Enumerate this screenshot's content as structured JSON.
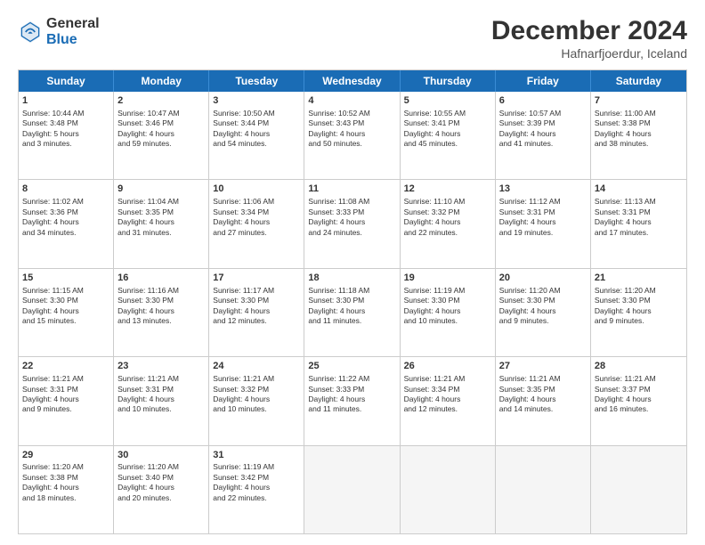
{
  "logo": {
    "general": "General",
    "blue": "Blue"
  },
  "header": {
    "month": "December 2024",
    "location": "Hafnarfjoerdur, Iceland"
  },
  "days": [
    "Sunday",
    "Monday",
    "Tuesday",
    "Wednesday",
    "Thursday",
    "Friday",
    "Saturday"
  ],
  "weeks": [
    [
      {
        "day": "1",
        "info": "Sunrise: 10:44 AM\nSunset: 3:48 PM\nDaylight: 5 hours\nand 3 minutes."
      },
      {
        "day": "2",
        "info": "Sunrise: 10:47 AM\nSunset: 3:46 PM\nDaylight: 4 hours\nand 59 minutes."
      },
      {
        "day": "3",
        "info": "Sunrise: 10:50 AM\nSunset: 3:44 PM\nDaylight: 4 hours\nand 54 minutes."
      },
      {
        "day": "4",
        "info": "Sunrise: 10:52 AM\nSunset: 3:43 PM\nDaylight: 4 hours\nand 50 minutes."
      },
      {
        "day": "5",
        "info": "Sunrise: 10:55 AM\nSunset: 3:41 PM\nDaylight: 4 hours\nand 45 minutes."
      },
      {
        "day": "6",
        "info": "Sunrise: 10:57 AM\nSunset: 3:39 PM\nDaylight: 4 hours\nand 41 minutes."
      },
      {
        "day": "7",
        "info": "Sunrise: 11:00 AM\nSunset: 3:38 PM\nDaylight: 4 hours\nand 38 minutes."
      }
    ],
    [
      {
        "day": "8",
        "info": "Sunrise: 11:02 AM\nSunset: 3:36 PM\nDaylight: 4 hours\nand 34 minutes."
      },
      {
        "day": "9",
        "info": "Sunrise: 11:04 AM\nSunset: 3:35 PM\nDaylight: 4 hours\nand 31 minutes."
      },
      {
        "day": "10",
        "info": "Sunrise: 11:06 AM\nSunset: 3:34 PM\nDaylight: 4 hours\nand 27 minutes."
      },
      {
        "day": "11",
        "info": "Sunrise: 11:08 AM\nSunset: 3:33 PM\nDaylight: 4 hours\nand 24 minutes."
      },
      {
        "day": "12",
        "info": "Sunrise: 11:10 AM\nSunset: 3:32 PM\nDaylight: 4 hours\nand 22 minutes."
      },
      {
        "day": "13",
        "info": "Sunrise: 11:12 AM\nSunset: 3:31 PM\nDaylight: 4 hours\nand 19 minutes."
      },
      {
        "day": "14",
        "info": "Sunrise: 11:13 AM\nSunset: 3:31 PM\nDaylight: 4 hours\nand 17 minutes."
      }
    ],
    [
      {
        "day": "15",
        "info": "Sunrise: 11:15 AM\nSunset: 3:30 PM\nDaylight: 4 hours\nand 15 minutes."
      },
      {
        "day": "16",
        "info": "Sunrise: 11:16 AM\nSunset: 3:30 PM\nDaylight: 4 hours\nand 13 minutes."
      },
      {
        "day": "17",
        "info": "Sunrise: 11:17 AM\nSunset: 3:30 PM\nDaylight: 4 hours\nand 12 minutes."
      },
      {
        "day": "18",
        "info": "Sunrise: 11:18 AM\nSunset: 3:30 PM\nDaylight: 4 hours\nand 11 minutes."
      },
      {
        "day": "19",
        "info": "Sunrise: 11:19 AM\nSunset: 3:30 PM\nDaylight: 4 hours\nand 10 minutes."
      },
      {
        "day": "20",
        "info": "Sunrise: 11:20 AM\nSunset: 3:30 PM\nDaylight: 4 hours\nand 9 minutes."
      },
      {
        "day": "21",
        "info": "Sunrise: 11:20 AM\nSunset: 3:30 PM\nDaylight: 4 hours\nand 9 minutes."
      }
    ],
    [
      {
        "day": "22",
        "info": "Sunrise: 11:21 AM\nSunset: 3:31 PM\nDaylight: 4 hours\nand 9 minutes."
      },
      {
        "day": "23",
        "info": "Sunrise: 11:21 AM\nSunset: 3:31 PM\nDaylight: 4 hours\nand 10 minutes."
      },
      {
        "day": "24",
        "info": "Sunrise: 11:21 AM\nSunset: 3:32 PM\nDaylight: 4 hours\nand 10 minutes."
      },
      {
        "day": "25",
        "info": "Sunrise: 11:22 AM\nSunset: 3:33 PM\nDaylight: 4 hours\nand 11 minutes."
      },
      {
        "day": "26",
        "info": "Sunrise: 11:21 AM\nSunset: 3:34 PM\nDaylight: 4 hours\nand 12 minutes."
      },
      {
        "day": "27",
        "info": "Sunrise: 11:21 AM\nSunset: 3:35 PM\nDaylight: 4 hours\nand 14 minutes."
      },
      {
        "day": "28",
        "info": "Sunrise: 11:21 AM\nSunset: 3:37 PM\nDaylight: 4 hours\nand 16 minutes."
      }
    ],
    [
      {
        "day": "29",
        "info": "Sunrise: 11:20 AM\nSunset: 3:38 PM\nDaylight: 4 hours\nand 18 minutes."
      },
      {
        "day": "30",
        "info": "Sunrise: 11:20 AM\nSunset: 3:40 PM\nDaylight: 4 hours\nand 20 minutes."
      },
      {
        "day": "31",
        "info": "Sunrise: 11:19 AM\nSunset: 3:42 PM\nDaylight: 4 hours\nand 22 minutes."
      },
      null,
      null,
      null,
      null
    ]
  ]
}
